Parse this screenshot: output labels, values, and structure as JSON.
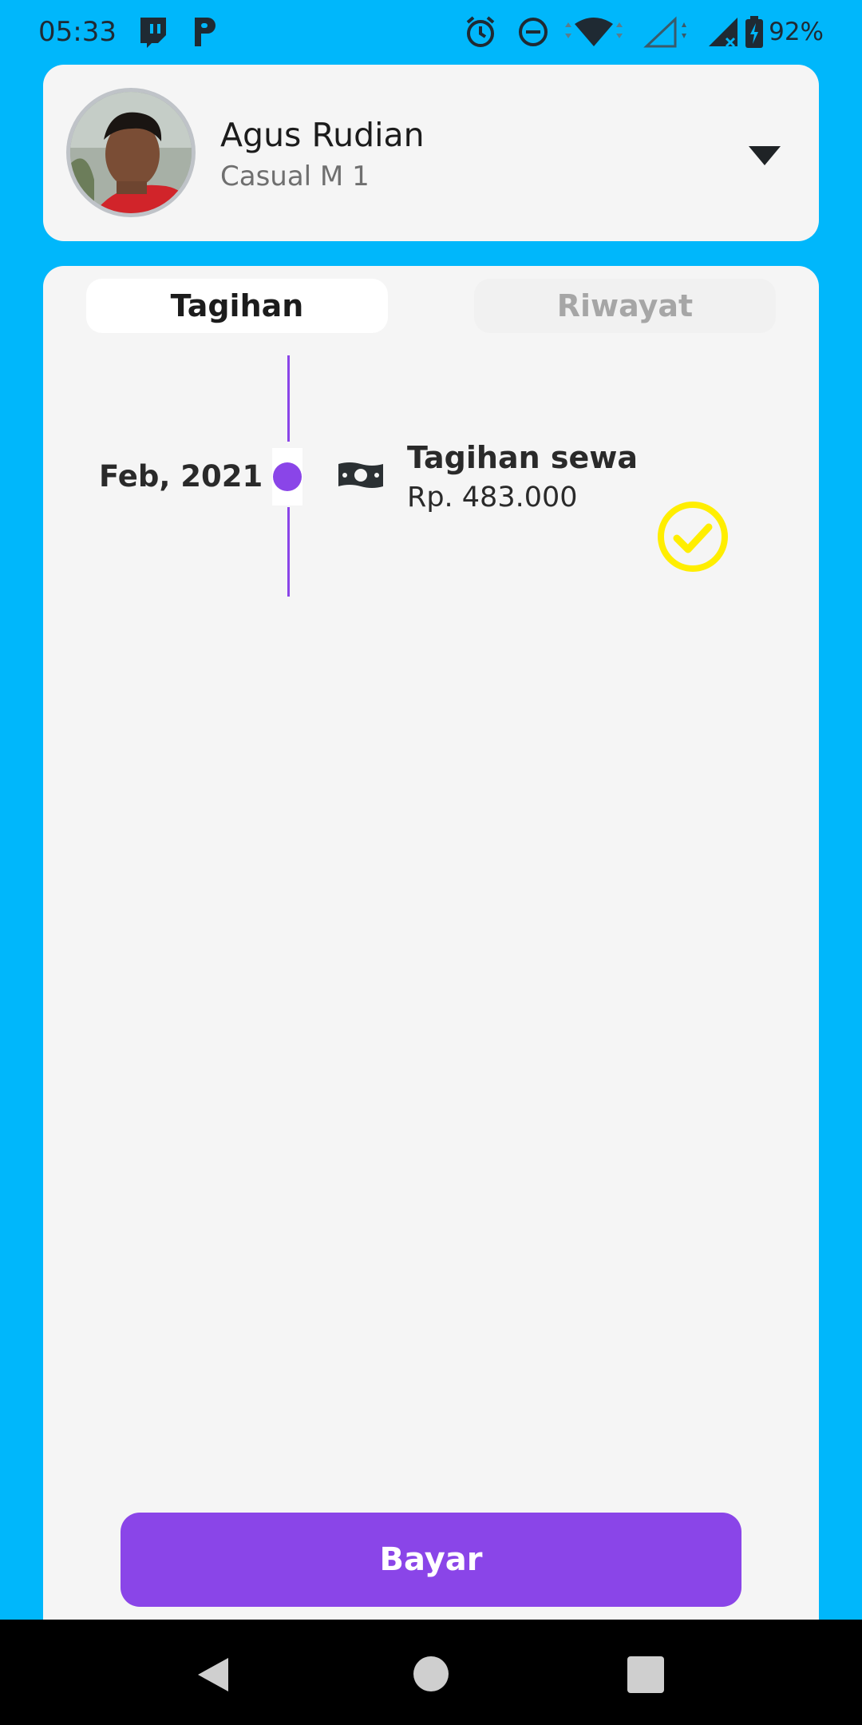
{
  "status_bar": {
    "time": "05:33",
    "battery": "92%",
    "icons": [
      "twitch-icon",
      "parking-icon",
      "alarm-icon",
      "do-not-disturb-icon",
      "wifi-icon",
      "signal-empty-icon",
      "signal-icon",
      "battery-charging-icon"
    ]
  },
  "profile": {
    "name": "Agus Rudian",
    "room": "Casual M 1",
    "dropdown_icon": "chevron-down-icon"
  },
  "tabs": [
    {
      "label": "Tagihan",
      "active": true
    },
    {
      "label": "Riwayat",
      "active": false
    }
  ],
  "timeline": {
    "entries": [
      {
        "date": "Feb, 2021",
        "title": "Tagihan sewa",
        "amount": "Rp. 483.000",
        "status": "paid",
        "icon": "money-icon"
      }
    ]
  },
  "actions": {
    "pay_label": "Bayar"
  },
  "colors": {
    "background": "#00B7FB",
    "card": "#F5F5F5",
    "accent": "#8A45E8",
    "check": "#FFEE00"
  },
  "nav": {
    "icons": [
      "back-icon",
      "home-icon",
      "recents-icon"
    ]
  }
}
